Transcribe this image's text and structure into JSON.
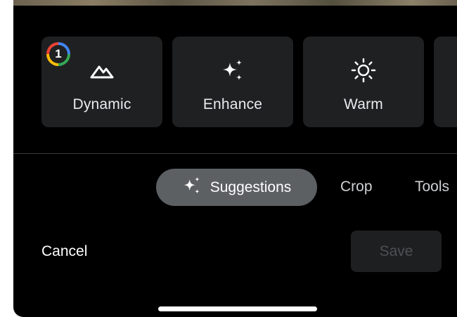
{
  "suggestions": [
    {
      "label": "Dynamic",
      "icon": "mountain-icon",
      "badge": "1"
    },
    {
      "label": "Enhance",
      "icon": "sparkle-icon"
    },
    {
      "label": "Warm",
      "icon": "sun-icon"
    }
  ],
  "tabs": {
    "active": {
      "label": "Suggestions",
      "icon": "sparkle-icon"
    },
    "crop": "Crop",
    "tools": "Tools"
  },
  "actions": {
    "cancel": "Cancel",
    "save": "Save"
  },
  "colors": {
    "background": "#000000",
    "chip": "#1f2021",
    "active_tab": "#5d6063",
    "disabled_text": "#4d4f52"
  }
}
